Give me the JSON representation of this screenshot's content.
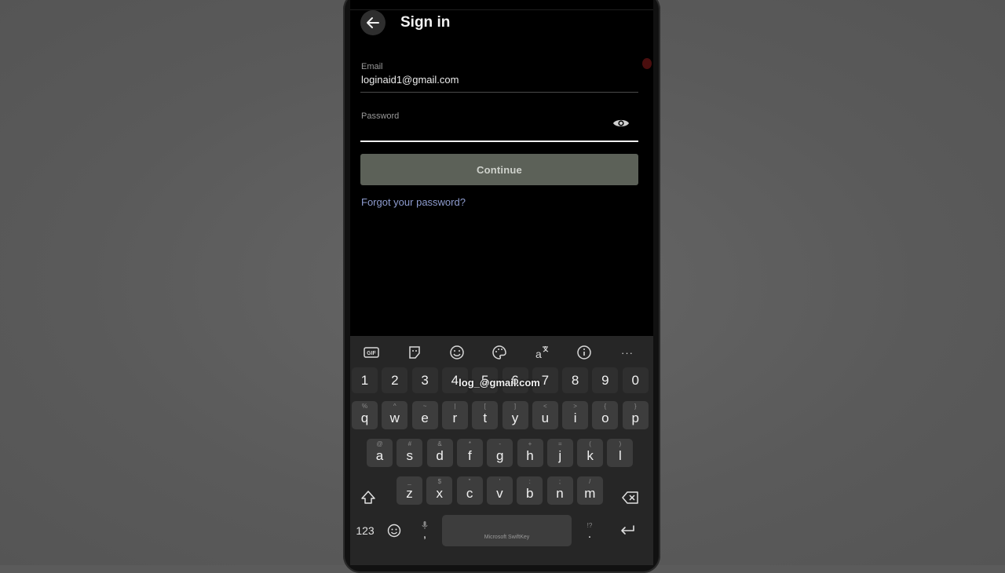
{
  "header": {
    "title": "Sign in"
  },
  "form": {
    "email_label": "Email",
    "email_value": "loginaid1@gmail.com",
    "password_label": "Password",
    "password_value": "",
    "continue_label": "Continue",
    "forgot_label": "Forgot your password?"
  },
  "keyboard": {
    "toolbar": [
      "gif-icon",
      "sticker-icon",
      "emoji-icon",
      "palette-icon",
      "translate-icon",
      "info-icon",
      "more-icon"
    ],
    "gif_label": "GIF",
    "more_label": "···",
    "suggestion": "log_@gmail.com",
    "number_row": [
      "1",
      "2",
      "3",
      "4",
      "5",
      "6",
      "7",
      "8",
      "9",
      "0"
    ],
    "row1": [
      {
        "k": "q",
        "h": "%"
      },
      {
        "k": "w",
        "h": "^"
      },
      {
        "k": "e",
        "h": "~"
      },
      {
        "k": "r",
        "h": "|"
      },
      {
        "k": "t",
        "h": "["
      },
      {
        "k": "y",
        "h": "]"
      },
      {
        "k": "u",
        "h": "<"
      },
      {
        "k": "i",
        "h": ">"
      },
      {
        "k": "o",
        "h": "{"
      },
      {
        "k": "p",
        "h": "}"
      }
    ],
    "row2": [
      {
        "k": "a",
        "h": "@"
      },
      {
        "k": "s",
        "h": "#"
      },
      {
        "k": "d",
        "h": "&"
      },
      {
        "k": "f",
        "h": "*"
      },
      {
        "k": "g",
        "h": "-"
      },
      {
        "k": "h",
        "h": "+"
      },
      {
        "k": "j",
        "h": "="
      },
      {
        "k": "k",
        "h": "("
      },
      {
        "k": "l",
        "h": ")"
      }
    ],
    "row3": [
      {
        "k": "z",
        "h": "_"
      },
      {
        "k": "x",
        "h": "$"
      },
      {
        "k": "c",
        "h": "\""
      },
      {
        "k": "v",
        "h": "'"
      },
      {
        "k": "b",
        "h": ":"
      },
      {
        "k": "n",
        "h": ";"
      },
      {
        "k": "m",
        "h": "/"
      }
    ],
    "num_toggle": "123",
    "comma": ",",
    "period": ".",
    "period_hint": "!?",
    "space_label": "Microsoft SwiftKey"
  },
  "colors": {
    "accent_link": "#8e9ccf",
    "button_bg": "#5c6158"
  }
}
